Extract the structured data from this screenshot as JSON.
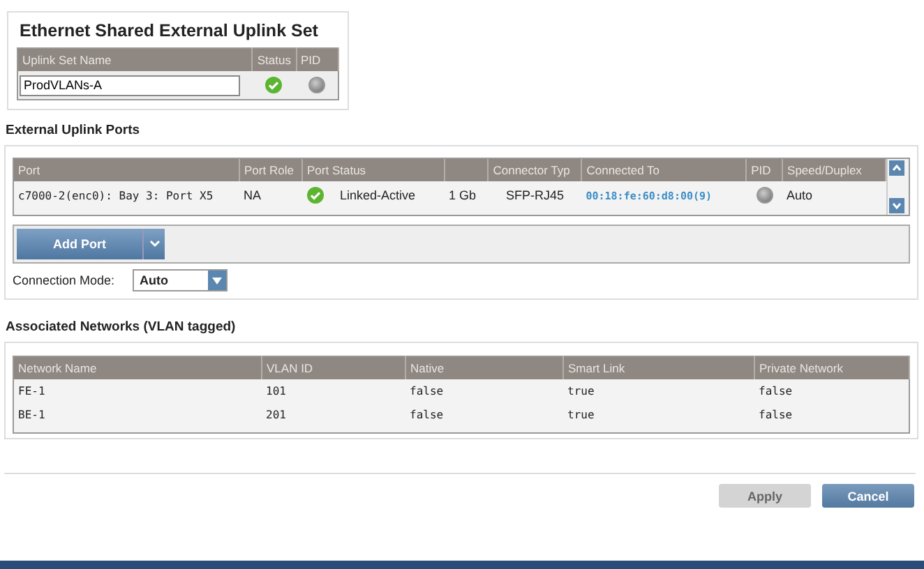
{
  "uplink_set": {
    "title": "Ethernet Shared External Uplink Set",
    "columns": [
      "Uplink Set Name",
      "Status",
      "PID"
    ],
    "name_value": "ProdVLANs-A",
    "status_ok": true,
    "pid_on": false
  },
  "ports": {
    "title": "External Uplink Ports",
    "columns": [
      "Port",
      "Port Role",
      "Port Status",
      "",
      "Connector Typ",
      "Connected To",
      "PID",
      "Speed/Duplex"
    ],
    "rows": [
      {
        "port": "c7000-2(enc0): Bay 3: Port X5",
        "role": "NA",
        "status_ok": true,
        "status_text": "Linked-Active",
        "speed": "1 Gb",
        "connector": "SFP-RJ45",
        "connected_to": "00:18:fe:60:d8:00(9)",
        "pid_on": false,
        "duplex": "Auto"
      }
    ],
    "add_button": "Add Port",
    "connection_mode_label": "Connection Mode:",
    "connection_mode": "Auto"
  },
  "networks": {
    "title": "Associated Networks (VLAN tagged)",
    "columns": [
      "Network Name",
      "VLAN ID",
      "Native",
      "Smart Link",
      "Private Network"
    ],
    "rows": [
      [
        "FE-1",
        "101",
        "false",
        "true",
        "false"
      ],
      [
        "BE-1",
        "201",
        "false",
        "true",
        "false"
      ]
    ]
  },
  "buttons": [
    {
      "label": "Apply",
      "kind": "apply",
      "disabled": true
    },
    {
      "label": "Cancel",
      "kind": "cancel",
      "disabled": false
    }
  ]
}
